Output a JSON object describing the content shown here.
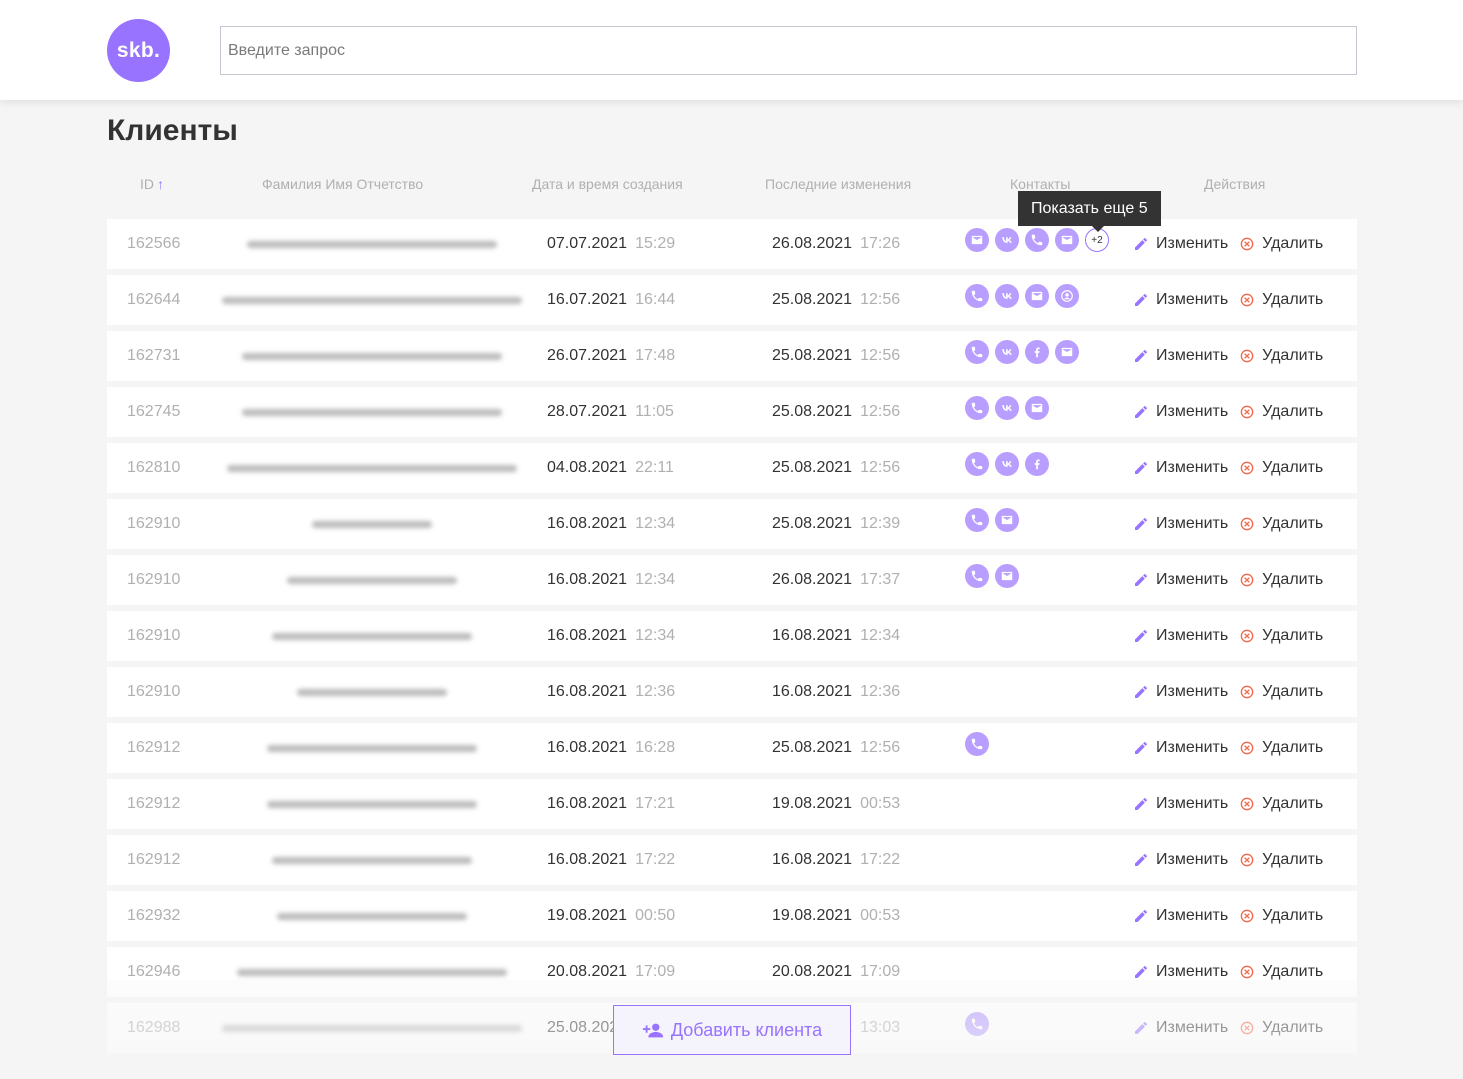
{
  "header": {
    "logo": "skb.",
    "search_placeholder": "Введите запрос"
  },
  "page_title": "Клиенты",
  "columns": {
    "id": "ID",
    "id_sort": "↑",
    "name": "Фамилия Имя Отчетство",
    "created": "Дата и время создания",
    "updated": "Последние изменения",
    "contacts": "Контакты",
    "actions": "Действия"
  },
  "tooltip": "Показать еще 5",
  "actions": {
    "edit": "Изменить",
    "delete": "Удалить"
  },
  "add_button": "Добавить клиента",
  "colors": {
    "accent": "#9873ff",
    "contact_icon": "#b89eff",
    "delete_icon": "#f06a4d"
  },
  "rows": [
    {
      "id": "162566",
      "created_date": "07.07.2021",
      "created_time": "15:29",
      "updated_date": "26.08.2021",
      "updated_time": "17:26",
      "contacts": [
        "mail-icon",
        "vk-icon",
        "phone-icon",
        "mail-icon",
        "more"
      ],
      "more": "+2",
      "name_width": 250
    },
    {
      "id": "162644",
      "created_date": "16.07.2021",
      "created_time": "16:44",
      "updated_date": "25.08.2021",
      "updated_time": "12:56",
      "contacts": [
        "phone-icon",
        "vk-icon",
        "mail-icon",
        "user-icon"
      ],
      "name_width": 300
    },
    {
      "id": "162731",
      "created_date": "26.07.2021",
      "created_time": "17:48",
      "updated_date": "25.08.2021",
      "updated_time": "12:56",
      "contacts": [
        "phone-icon",
        "vk-icon",
        "facebook-icon",
        "mail-icon"
      ],
      "name_width": 260
    },
    {
      "id": "162745",
      "created_date": "28.07.2021",
      "created_time": "11:05",
      "updated_date": "25.08.2021",
      "updated_time": "12:56",
      "contacts": [
        "phone-icon",
        "vk-icon",
        "mail-icon"
      ],
      "name_width": 260
    },
    {
      "id": "162810",
      "created_date": "04.08.2021",
      "created_time": "22:11",
      "updated_date": "25.08.2021",
      "updated_time": "12:56",
      "contacts": [
        "phone-icon",
        "vk-icon",
        "facebook-icon"
      ],
      "name_width": 290
    },
    {
      "id": "162910",
      "created_date": "16.08.2021",
      "created_time": "12:34",
      "updated_date": "25.08.2021",
      "updated_time": "12:39",
      "contacts": [
        "phone-icon",
        "mail-icon"
      ],
      "name_width": 120
    },
    {
      "id": "162910",
      "created_date": "16.08.2021",
      "created_time": "12:34",
      "updated_date": "26.08.2021",
      "updated_time": "17:37",
      "contacts": [
        "phone-icon",
        "mail-icon"
      ],
      "name_width": 170
    },
    {
      "id": "162910",
      "created_date": "16.08.2021",
      "created_time": "12:34",
      "updated_date": "16.08.2021",
      "updated_time": "12:34",
      "contacts": [],
      "name_width": 200
    },
    {
      "id": "162910",
      "created_date": "16.08.2021",
      "created_time": "12:36",
      "updated_date": "16.08.2021",
      "updated_time": "12:36",
      "contacts": [],
      "name_width": 150
    },
    {
      "id": "162912",
      "created_date": "16.08.2021",
      "created_time": "16:28",
      "updated_date": "25.08.2021",
      "updated_time": "12:56",
      "contacts": [
        "phone-icon"
      ],
      "name_width": 210
    },
    {
      "id": "162912",
      "created_date": "16.08.2021",
      "created_time": "17:21",
      "updated_date": "19.08.2021",
      "updated_time": "00:53",
      "contacts": [],
      "name_width": 210
    },
    {
      "id": "162912",
      "created_date": "16.08.2021",
      "created_time": "17:22",
      "updated_date": "16.08.2021",
      "updated_time": "17:22",
      "contacts": [],
      "name_width": 200
    },
    {
      "id": "162932",
      "created_date": "19.08.2021",
      "created_time": "00:50",
      "updated_date": "19.08.2021",
      "updated_time": "00:53",
      "contacts": [],
      "name_width": 190
    },
    {
      "id": "162946",
      "created_date": "20.08.2021",
      "created_time": "17:09",
      "updated_date": "20.08.2021",
      "updated_time": "17:09",
      "contacts": [],
      "name_width": 270
    },
    {
      "id": "162988",
      "created_date": "25.08.2021",
      "created_time": "13:03",
      "updated_date": "25.08.2021",
      "updated_time": "13:03",
      "contacts": [
        "phone-icon"
      ],
      "name_width": 300
    }
  ]
}
